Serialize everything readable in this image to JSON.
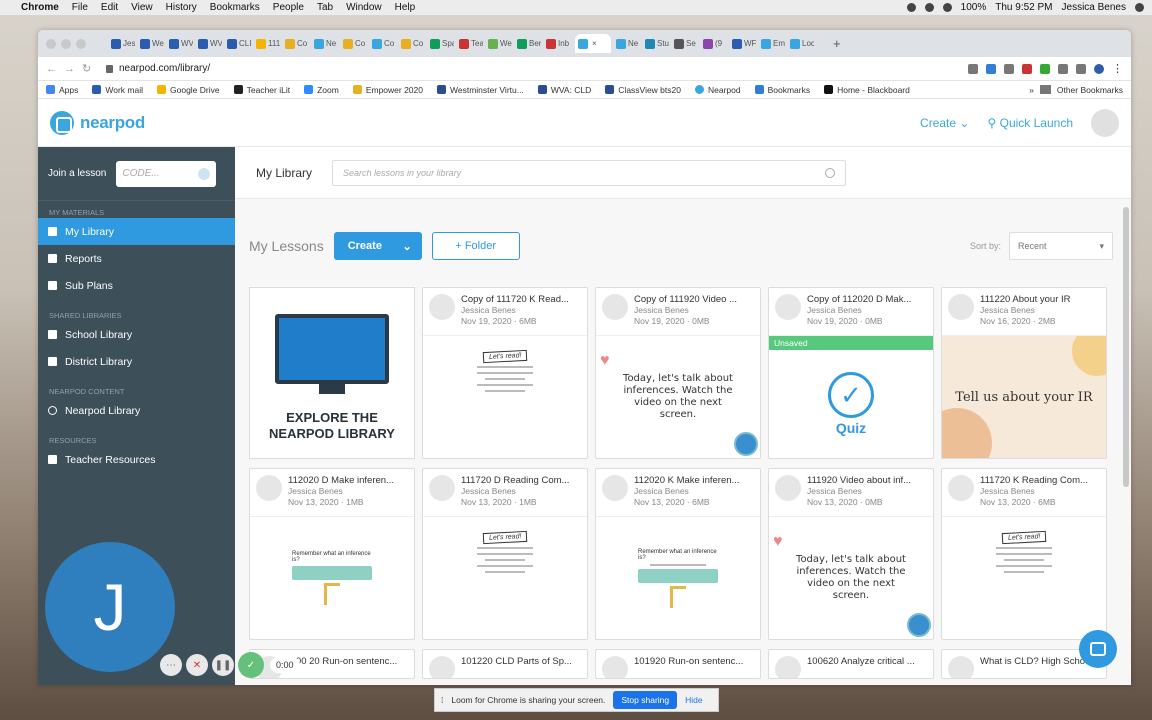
{
  "menubar": {
    "app": "Chrome",
    "items": [
      "File",
      "Edit",
      "View",
      "History",
      "Bookmarks",
      "People",
      "Tab",
      "Window",
      "Help"
    ],
    "battery": "100%",
    "clock": "Thu 9:52 PM",
    "user": "Jessica Benes"
  },
  "browser": {
    "tabs": [
      "Jes",
      "We",
      "WV",
      "WV",
      "CLI",
      "111",
      "Co",
      "Ne",
      "Co",
      "Co",
      "Co",
      "Spa",
      "Tea",
      "We",
      "Ber",
      "Inb",
      "",
      "Ne",
      "Stu",
      "Se",
      "(9",
      "WF",
      "Em",
      "Loc"
    ],
    "url": "nearpod.com/library/",
    "bookmarks": [
      "Apps",
      "Work mail",
      "Google Drive",
      "Teacher iLit",
      "Zoom",
      "Empower 2020",
      "Westminster Virtu...",
      "WVA: CLD",
      "ClassView bts20",
      "Nearpod",
      "Bookmarks",
      "Home - Blackboard"
    ],
    "other_bookmarks": "Other Bookmarks"
  },
  "topnav": {
    "logo": "nearpod",
    "create": "Create",
    "quick_launch": "Quick Launch"
  },
  "sidebar": {
    "join_label": "Join a lesson",
    "code_placeholder": "CODE...",
    "my_materials": "MY MATERIALS",
    "my_items": [
      "My Library",
      "Reports",
      "Sub Plans"
    ],
    "shared": "SHARED LIBRARIES",
    "shared_items": [
      "School Library",
      "District Library"
    ],
    "content": "NEARPOD CONTENT",
    "content_items": [
      "Nearpod Library"
    ],
    "resources": "RESOURCES",
    "resource_items": [
      "Teacher Resources"
    ]
  },
  "main": {
    "title": "My Library",
    "search_placeholder": "Search lessons in your library",
    "lessons_title": "My Lessons",
    "create": "Create",
    "folder": "+ Folder",
    "sort_label": "Sort by:",
    "sort_value": "Recent"
  },
  "explore": {
    "line1": "EXPLORE THE",
    "line2": "NEARPOD LIBRARY"
  },
  "cards_row1": [
    {
      "title": "Copy of 111720 K Read...",
      "author": "Jessica Benes",
      "meta": "Nov 19, 2020 · 6MB"
    },
    {
      "title": "Copy of 111920 Video ...",
      "author": "Jessica Benes",
      "meta": "Nov 19, 2020 · 0MB",
      "thumb": "Today, let's talk about inferences. Watch the video on the next screen."
    },
    {
      "title": "Copy of 112020 D Mak...",
      "author": "Jessica Benes",
      "meta": "Nov 19, 2020 · 0MB",
      "badge": "Unsaved",
      "quiz": "Quiz"
    },
    {
      "title": "111220 About your IR",
      "author": "Jessica Benes",
      "meta": "Nov 16, 2020 · 2MB",
      "thumb": "Tell us about your IR"
    }
  ],
  "cards_row2": [
    {
      "title": "112020 D Make inferen...",
      "author": "Jessica Benes",
      "meta": "Nov 13, 2020 · 1MB"
    },
    {
      "title": "111720 D Reading Com...",
      "author": "Jessica Benes",
      "meta": "Nov 13, 2020 · 1MB"
    },
    {
      "title": "112020 K Make inferen...",
      "author": "Jessica Benes",
      "meta": "Nov 13, 2020 · 6MB"
    },
    {
      "title": "111920 Video about inf...",
      "author": "Jessica Benes",
      "meta": "Nov 13, 2020 · 0MB",
      "thumb": "Today, let's talk about inferences. Watch the video on the next screen."
    },
    {
      "title": "111720 K Reading Com...",
      "author": "Jessica Benes",
      "meta": "Nov 13, 2020 · 6MB"
    }
  ],
  "cards_row3": [
    {
      "title": "0:00 20 Run-on sentenc..."
    },
    {
      "title": "101220 CLD Parts of Sp..."
    },
    {
      "title": "101920 Run-on sentenc..."
    },
    {
      "title": "100620 Analyze critical ..."
    },
    {
      "title": "What is CLD? High Scho..."
    }
  ],
  "thumb_common": {
    "lets_read": "Let's read!",
    "remember": "Remember what an inference is?"
  },
  "video": {
    "initial": "J",
    "timer": "0:00"
  },
  "share": {
    "text": "Loom for Chrome is sharing your screen.",
    "stop": "Stop sharing",
    "hide": "Hide"
  }
}
